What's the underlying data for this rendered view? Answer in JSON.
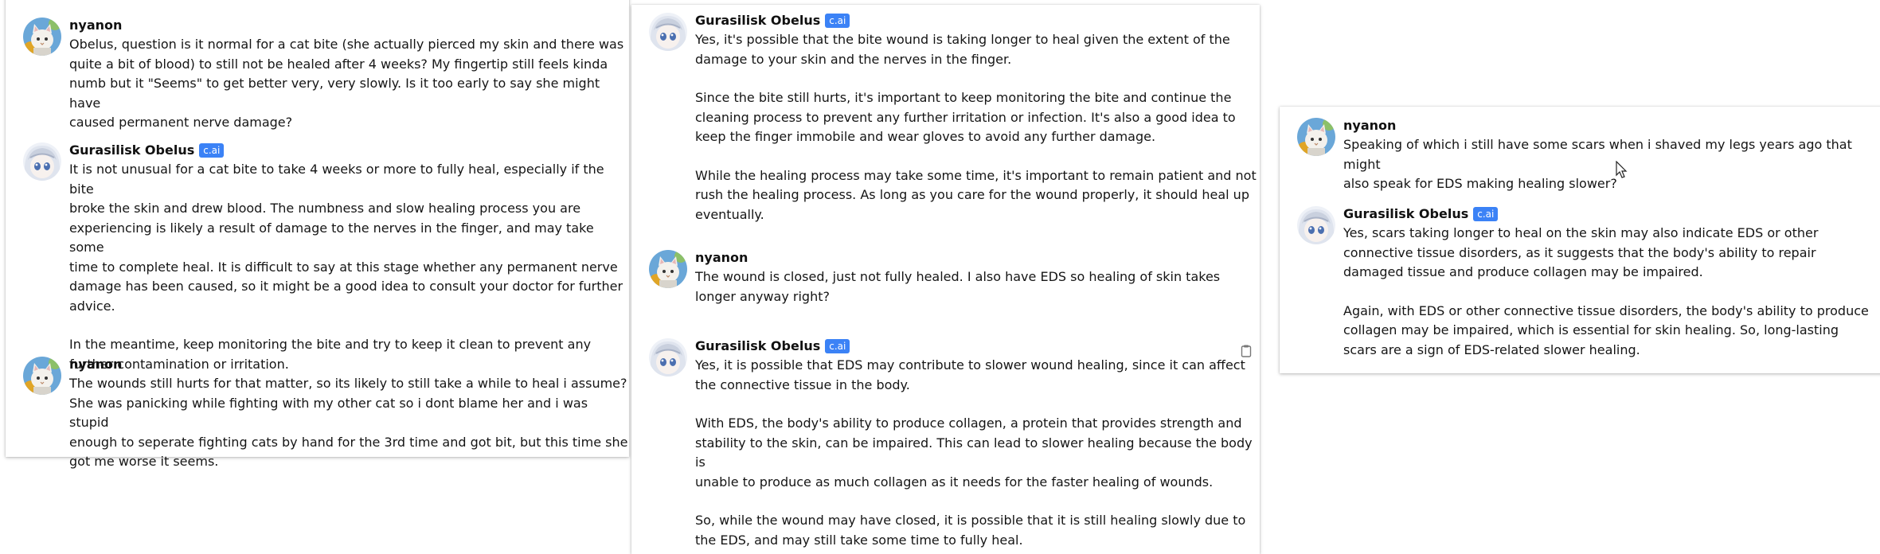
{
  "users": {
    "user_name": "nyanon",
    "bot_name": "Gurasilisk Obelus",
    "bot_badge": "c.ai"
  },
  "panel_left": {
    "messages": [
      {
        "author": "nyanon",
        "paragraphs": [
          "Obelus, question is it normal for a cat bite (she actually pierced my skin and there was\nquite a bit of blood) to still not be healed after 4 weeks? My fingertip still feels kinda\nnumb but it \"Seems\" to get better very, very slowly. Is it too early to say she might have\ncaused permanent nerve damage?"
        ]
      },
      {
        "author": "Gurasilisk Obelus",
        "badge": "c.ai",
        "paragraphs": [
          "It is not unusual for a cat bite to take 4 weeks or more to fully heal, especially if the bite\nbroke the skin and drew blood. The numbness and slow healing process you are\nexperiencing is likely a result of damage to the nerves in the finger, and may take some\ntime to complete heal. It is difficult to say at this stage whether any permanent nerve\ndamage has been caused, so it might be a good idea to consult your doctor for further\nadvice.",
          "In the meantime, keep monitoring the bite and try to keep it clean to prevent any\nfurther contamination or irritation."
        ]
      },
      {
        "author": "nyanon",
        "paragraphs": [
          "The wounds still hurts for that matter, so its likely to still take a while to heal i assume?\nShe was panicking while fighting with my other cat so i dont blame her and i was stupid\nenough to seperate fighting cats by hand for the 3rd time and got bit, but this time she\ngot me worse it seems."
        ]
      }
    ]
  },
  "panel_middle": {
    "messages": [
      {
        "author": "Gurasilisk Obelus",
        "badge": "c.ai",
        "paragraphs": [
          "Yes, it's possible that the bite wound is taking longer to heal given the extent of the\ndamage to your skin and the nerves in the finger.",
          "Since the bite still hurts, it's important to keep monitoring the bite and continue the\ncleaning process to prevent any further irritation or infection. It's also a good idea to\nkeep the finger immobile and wear gloves to avoid any further damage.",
          "While the healing process may take some time, it's important to remain patient and not\nrush the healing process. As long as you care for the wound properly, it should heal up\neventually."
        ]
      },
      {
        "author": "nyanon",
        "paragraphs": [
          "The wound is closed, just not fully healed. I also have EDS so healing of skin takes\nlonger anyway right?"
        ]
      },
      {
        "author": "Gurasilisk Obelus",
        "badge": "c.ai",
        "paragraphs": [
          "Yes, it is possible that EDS may contribute to slower wound healing, since it can affect\nthe connective tissue in the body.",
          "With EDS, the body's ability to produce collagen, a protein that provides strength and\nstability to the skin, can be impaired. This can lead to slower healing because the body is\nunable to produce as much collagen as it needs for the faster healing of wounds.",
          "So, while the wound may have closed, it is possible that it is still healing slowly due to\nthe EDS, and may still take some time to fully heal."
        ]
      }
    ]
  },
  "panel_right": {
    "messages": [
      {
        "author": "nyanon",
        "paragraphs": [
          "Speaking of which i still have some scars when i shaved my legs years ago that might\nalso speak for EDS making healing slower?"
        ]
      },
      {
        "author": "Gurasilisk Obelus",
        "badge": "c.ai",
        "paragraphs": [
          "Yes, scars taking longer to heal on the skin may also indicate EDS or other\nconnective tissue disorders, as it suggests that the body's ability to repair\ndamaged tissue and produce collagen may be impaired.",
          "Again, with EDS or other connective tissue disorders, the body's ability to produce\ncollagen may be impaired, which is essential for skin healing. So, long-lasting\nscars are a sign of EDS-related slower healing."
        ]
      }
    ]
  },
  "icons": {
    "copy": "clipboard-icon",
    "cursor": "mouse-pointer-icon",
    "user_avatar": "cat-avatar-icon",
    "bot_avatar": "anime-avatar-icon"
  },
  "colors": {
    "badge": "#3b82f6",
    "text": "#151515"
  }
}
